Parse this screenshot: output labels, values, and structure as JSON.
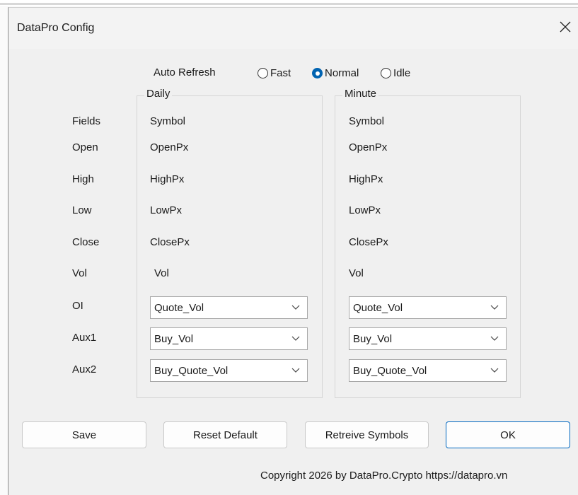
{
  "window": {
    "title": "DataPro Config"
  },
  "auto_refresh": {
    "label": "Auto Refresh",
    "options": [
      {
        "label": "Fast",
        "checked": false
      },
      {
        "label": "Normal",
        "checked": true
      },
      {
        "label": "Idle",
        "checked": false
      }
    ]
  },
  "row_labels": [
    "Fields",
    "Open",
    "High",
    "Low",
    "Close",
    "Vol",
    "OI",
    "Aux1",
    "Aux2"
  ],
  "daily": {
    "title": "Daily",
    "fields": [
      "Symbol",
      "OpenPx",
      "HighPx",
      "LowPx",
      "ClosePx",
      "Vol"
    ],
    "oi": "Quote_Vol",
    "aux1": "Buy_Vol",
    "aux2": "Buy_Quote_Vol"
  },
  "minute": {
    "title": "Minute",
    "fields": [
      "Symbol",
      "OpenPx",
      "HighPx",
      "LowPx",
      "ClosePx",
      "Vol"
    ],
    "oi": "Quote_Vol",
    "aux1": "Buy_Vol",
    "aux2": "Buy_Quote_Vol"
  },
  "buttons": {
    "save": "Save",
    "reset": "Reset Default",
    "retrieve": "Retreive Symbols",
    "ok": "OK"
  },
  "footer": "Copyright 2026 by DataPro.Crypto https://datapro.vn",
  "icons": {
    "close": "close-icon",
    "dropdown": "chevron-down-icon"
  },
  "colors": {
    "accent": "#0063b1",
    "default_button_border": "#0067c0"
  }
}
